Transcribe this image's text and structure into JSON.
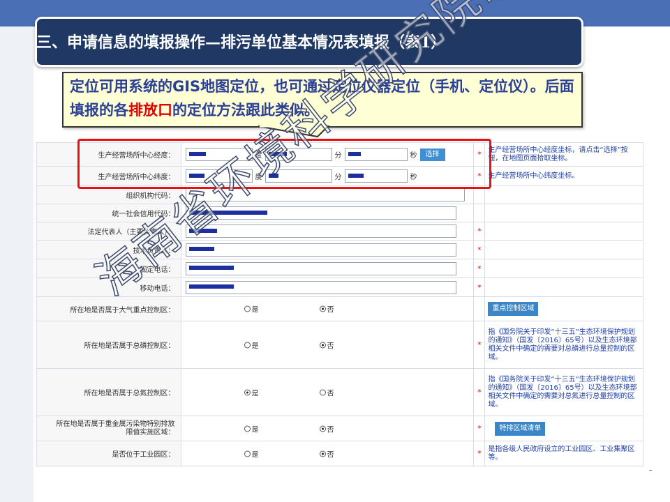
{
  "slide": {
    "title": "三、申请信息的填报操作—排污单位基本情况表填报（表1）",
    "callout_part1": "定位可用系统的GIS地图定位，也可通过定位仪器定位（手机、定位仪）。后面填报的各",
    "callout_highlight": "排放口",
    "callout_part2": "的定位方法跟此类似。",
    "watermark": "海南省环境科学研究院制",
    "page_dash": "-"
  },
  "form": {
    "lon_label": "生产经营场所中心经度：",
    "lat_label": "生产经营场所中心纬度：",
    "unit_degree": "度",
    "unit_minute": "分",
    "unit_second": "秒",
    "pick_button": "选择",
    "lon_note": "生产经营场所中心经度坐标，请点击“选择”按钮，在地图页面拾取坐标。",
    "lat_note": "生产经营场所中心纬度坐标。",
    "org_code_label": "组织机构代码：",
    "credit_code_label": "统一社会信用代码：",
    "legal_rep_label": "法定代表人（主要负责人）：",
    "tech_lead_label": "技术负责人：",
    "phone_label": "固定电话：",
    "mobile_label": "移动电话：",
    "required_mark": "*",
    "yes": "是",
    "no": "否",
    "air_label": "所在地是否属于大气重点控制区：",
    "air_button": "重点控制区域",
    "phos_label": "所在地是否属于总磷控制区：",
    "phos_note": "指《国务院关于印发“十三五”生态环境保护规划的通知》（国发〔2016〕65号）以及生态环境部相关文件中确定的需要对总磷进行总量控制的区域。",
    "nitro_label": "所在地是否属于总氮控制区：",
    "nitro_note": "指《国务院关于印发“十三五”生态环境保护规划的通知》（国发〔2016〕65号）以及生态环境部相关文件中确定的需要对总氮进行总量控制的区域。",
    "heavy_label_1": "所在地是否属于重金属污染物特别排放",
    "heavy_label_2": "限值实施区域：",
    "heavy_button": "特排区域清单",
    "park_label": "是否位于工业园区：",
    "park_note": "是指各级人民政府设立的工业园区、工业集聚区等。"
  },
  "radios": {
    "air": "no",
    "phos": "no",
    "nitro": "yes",
    "heavy": "no",
    "park": "no"
  },
  "colors": {
    "header_navy": "#1f3864",
    "callout_text": "#2a3f96",
    "highlight_red": "#e00000",
    "frame_red": "#e81010",
    "note_blue": "#1f3fa6",
    "button_blue": "#3a86c8"
  }
}
